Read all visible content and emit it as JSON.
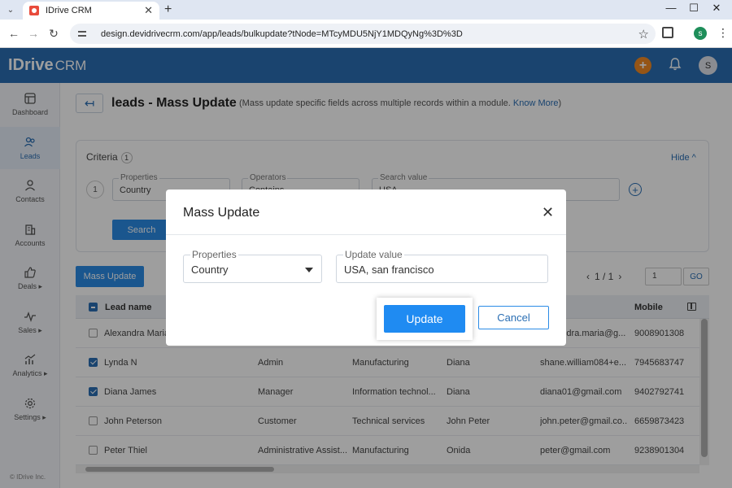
{
  "browser": {
    "tab_title": "IDrive CRM",
    "url": "design.devidrivecrm.com/app/leads/bulkupdate?tNode=MTcyMDU5NjY1MDQyNg%3D%3D",
    "profile_initial": "s"
  },
  "header": {
    "logo_main": "IDrive",
    "logo_sub": "CRM",
    "avatar_initial": "S"
  },
  "sidebar": {
    "items": [
      {
        "label": "Dashboard"
      },
      {
        "label": "Leads"
      },
      {
        "label": "Contacts"
      },
      {
        "label": "Accounts"
      },
      {
        "label": "Deals ▸"
      },
      {
        "label": "Sales ▸"
      },
      {
        "label": "Analytics ▸"
      },
      {
        "label": "Settings ▸"
      }
    ],
    "copyright": "© IDrive Inc."
  },
  "page": {
    "title": "leads - Mass Update",
    "subtitle": "(Mass update specific fields across multiple records within a module. ",
    "know_more": "Know More",
    "subtitle_end": ")"
  },
  "criteria": {
    "label": "Criteria",
    "count": "1",
    "hide": "Hide ^",
    "row_num": "1",
    "properties_label": "Properties",
    "properties_value": "Country",
    "operators_label": "Operators",
    "operators_value": "Contains",
    "search_value_label": "Search value",
    "search_value": "USA",
    "search_button": "Search"
  },
  "toolbar": {
    "mass_update": "Mass Update",
    "page_info": "1 / 1",
    "page_input": "1",
    "go": "GO"
  },
  "table": {
    "headers": {
      "lead_name": "Lead name",
      "mobile": "Mobile"
    },
    "rows": [
      {
        "name": "Alexandra Maria",
        "title": "",
        "industry": "",
        "owner": "",
        "email": "alexandra.maria@g...",
        "mobile": "9008901308",
        "checked": false
      },
      {
        "name": "Lynda N",
        "title": "Admin",
        "industry": "Manufacturing",
        "owner": "Diana",
        "email": "shane.william084+e...",
        "mobile": "7945683747",
        "checked": true
      },
      {
        "name": "Diana James",
        "title": "Manager",
        "industry": "Information technol...",
        "owner": "Diana",
        "email": "diana01@gmail.com",
        "mobile": "9402792741",
        "checked": true
      },
      {
        "name": "John Peterson",
        "title": "Customer",
        "industry": "Technical services",
        "owner": "John Peter",
        "email": "john.peter@gmail.co...",
        "mobile": "6659873423",
        "checked": false
      },
      {
        "name": "Peter Thiel",
        "title": "Administrative Assist...",
        "industry": "Manufacturing",
        "owner": "Onida",
        "email": "peter@gmail.com",
        "mobile": "9238901304",
        "checked": false
      }
    ]
  },
  "modal": {
    "title": "Mass Update",
    "properties_label": "Properties",
    "properties_value": "Country",
    "update_value_label": "Update value",
    "update_value": "USA, san francisco",
    "update_button": "Update",
    "cancel_button": "Cancel"
  },
  "colors": {
    "brand_blue": "#2b6fb4",
    "button_blue": "#2b8be6",
    "accent_orange": "#f08a24"
  }
}
